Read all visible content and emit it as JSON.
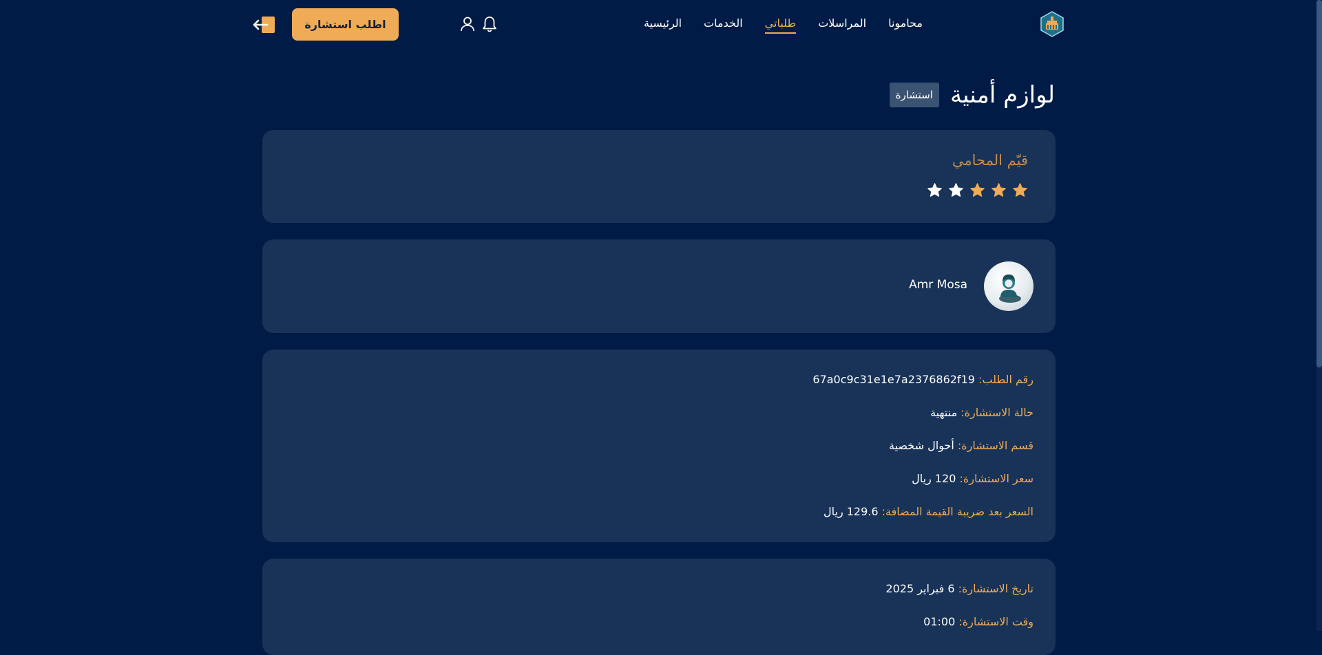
{
  "header": {
    "nav": [
      {
        "label": "الرئيسية",
        "active": false
      },
      {
        "label": "الخدمات",
        "active": false
      },
      {
        "label": "طلباتي",
        "active": true
      },
      {
        "label": "المراسلات",
        "active": false
      },
      {
        "label": "محامونا",
        "active": false
      }
    ],
    "cta_label": "اطلب استشارة",
    "icons": {
      "logo": "logo-icon",
      "notifications": "bell-icon",
      "profile": "user-icon",
      "logout": "logout-icon"
    }
  },
  "page": {
    "title": "لوازم أمنية",
    "type_badge": "استشارة"
  },
  "rating": {
    "title": "قيّم المحامي",
    "value": 3,
    "max": 5,
    "filled_color": "#f0ab57",
    "empty_color": "#ffffff"
  },
  "lawyer": {
    "name": "Amr Mosa"
  },
  "details": [
    {
      "label": "رقم الطلب:",
      "value": "67a0c9c31e1e7a2376862f19"
    },
    {
      "label": "حالة الاستشارة:",
      "value": "منتهية"
    },
    {
      "label": "قسم الاستشارة:",
      "value": "أحوال شخصية"
    },
    {
      "label": "سعر الاستشارة:",
      "value": "120 ريال"
    },
    {
      "label": "السعر بعد ضريبة القيمة المضافة:",
      "value": "129.6 ريال"
    }
  ],
  "schedule": [
    {
      "label": "تاريخ الاستشارة:",
      "value": "6 فبراير 2025"
    },
    {
      "label": "وقت الاستشارة:",
      "value": "01:00"
    }
  ],
  "colors": {
    "background": "#001b45",
    "card": "#183357",
    "accent": "#f0ab57"
  }
}
